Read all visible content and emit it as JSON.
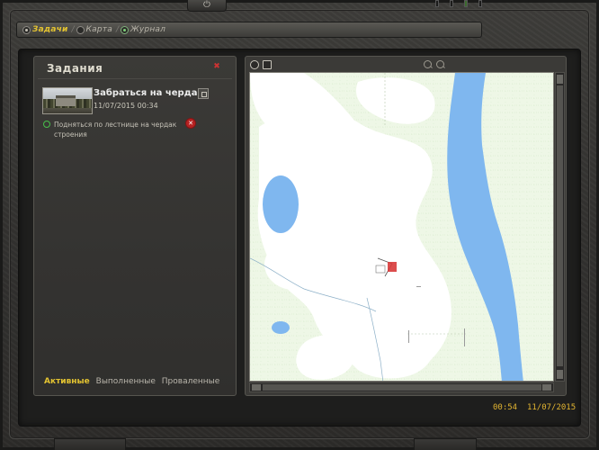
{
  "tabs": [
    {
      "label": "Задачи",
      "active": true
    },
    {
      "label": "Карта",
      "active": false
    },
    {
      "label": "Журнал",
      "active": false
    }
  ],
  "tasks_panel": {
    "title": "Задания",
    "quest": {
      "title": "Забраться на чердак",
      "datetime": "11/07/2015  00:34",
      "subtask": "Подняться по лестнице на чердак строения"
    },
    "filters": {
      "active": "Активные",
      "completed": "Выполненные",
      "failed": "Проваленные"
    }
  },
  "map": {
    "icons": [
      "compass-icon",
      "fit-icon",
      "zoom-in-icon",
      "zoom-out-icon"
    ],
    "colors": {
      "land": "#eef7e6",
      "clearing": "#ffffff",
      "water": "#7fb7ef",
      "marker": "#d83a3a"
    }
  },
  "status": {
    "time": "00:54",
    "date": "11/07/2015"
  },
  "colors": {
    "accent": "#e3c331",
    "subtask_status": "#47c04a",
    "cancel": "#b62222"
  }
}
